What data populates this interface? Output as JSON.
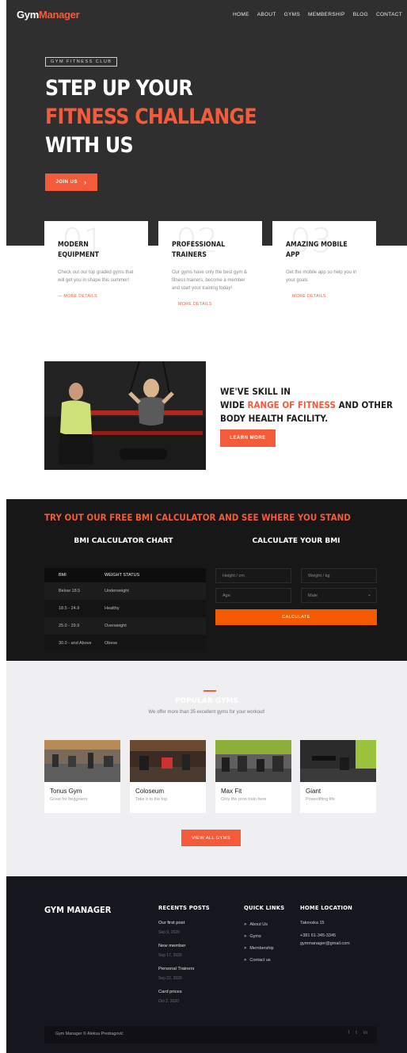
{
  "header": {
    "logo_a": "Gym",
    "logo_b": "Manager",
    "nav": [
      "HOME",
      "ABOUT",
      "GYMS",
      "MEMBERSHIP",
      "BLOG",
      "CONTACT"
    ]
  },
  "hero": {
    "tag": "GYM FITNESS CLUB",
    "line1": "STEP UP YOUR",
    "line2": "FITNESS CHALLANGE",
    "line3": "WITH US",
    "cta": "JOIN US",
    "cta_arrow": "›"
  },
  "features": [
    {
      "num": "01",
      "title": "MODERN EQUIPMENT",
      "desc": "Check out our top graded gyms that will get you in shape this summer!",
      "link": "— MORE DETAILS"
    },
    {
      "num": "02",
      "title": "PROFESSIONAL TRAINERS",
      "desc": "Our gyms have only the best gym & fitness trainers, become a member and start your training today!",
      "link": "MORE DETAILS"
    },
    {
      "num": "03",
      "title": "AMAZING MOBILE APP",
      "desc": "Get the mobile app so help you in your goals",
      "link": "MORE DETAILS"
    }
  ],
  "skill": {
    "line1": "WE'VE SKILL IN",
    "line2_pre": "WIDE ",
    "line2_hl": "RANGE OF FITNESS",
    "line2_post": " AND OTHER",
    "line3": "BODY HEALTH FACILITY.",
    "button": "LEARN MORE"
  },
  "bmi": {
    "heading": "TRY OUT OUR FREE BMI CALCULATOR AND SEE WHERE YOU STAND",
    "chart_title": "BMI CALCULATOR CHART",
    "calc_title": "CALCULATE YOUR BMI",
    "columns": [
      "BMI",
      "WEIGHT STATUS"
    ],
    "rows": [
      [
        "Below 18.5",
        "Underweight"
      ],
      [
        "18.5 - 24.9",
        "Healthy"
      ],
      [
        "25.0 - 29.9",
        "Overweight"
      ],
      [
        "30.0 - and Above",
        "Obese"
      ]
    ],
    "height_placeholder": "Height / cm",
    "weight_placeholder": "Weight / kg",
    "age_placeholder": "Age",
    "gender_value": "Male",
    "button": "CALCULATE"
  },
  "gyms": {
    "title": "POPULAR GYMS",
    "subtitle": "We offer more than 35 excellent gyms for your workout!",
    "items": [
      {
        "name": "Tonus Gym",
        "desc": "Great for beggniers"
      },
      {
        "name": "Coloseum",
        "desc": "Take it to the top"
      },
      {
        "name": "Max Fit",
        "desc": "Only the pros train here"
      },
      {
        "name": "Giant",
        "desc": "Powerlifting life"
      }
    ],
    "button": "VIEW ALL GYMS"
  },
  "footer": {
    "brand": "GYM MANAGER",
    "recent_title": "RECENTS POSTS",
    "posts": [
      {
        "title": "Our first post",
        "date": "Sep 9, 2020"
      },
      {
        "title": "New member",
        "date": "Sep 17, 2020"
      },
      {
        "title": "Personal Trainers",
        "date": "Sep 22, 2020"
      },
      {
        "title": "Card prices",
        "date": "Oct 2, 2020"
      }
    ],
    "links_title": "QUICK LINKS",
    "links": [
      "About Us",
      "Gyms",
      "Membership",
      "Contact us"
    ],
    "location_title": "HOME LOCATION",
    "address": "Takovska 15",
    "phone": "+381 61-345-3345",
    "email": "gymmanager@gmail.com",
    "copyright": "Gym Manager © Aleksa Predragović",
    "social": [
      "f",
      "t",
      "in"
    ]
  }
}
